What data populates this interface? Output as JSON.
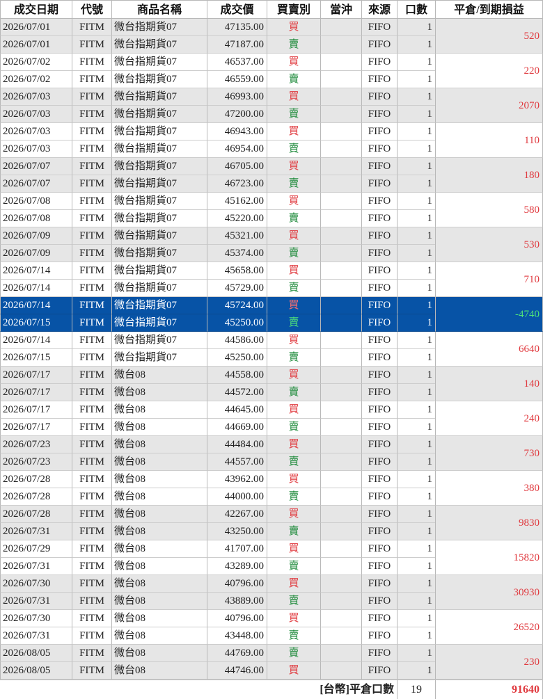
{
  "header": {
    "columns": [
      "成交日期",
      "代號",
      "商品名稱",
      "成交價",
      "買賣別",
      "當沖",
      "來源",
      "口數",
      "平倉/到期損益"
    ]
  },
  "side_labels": {
    "buy": "買",
    "sell": "賣"
  },
  "colors": {
    "buy": "#e0393e",
    "sell": "#1d8a3a",
    "selection": "#0753a6",
    "stripe": "#e6e6e6"
  },
  "pairs": [
    {
      "pnl": "520",
      "selected": false,
      "trades": [
        {
          "date": "2026/07/01",
          "code": "FITM",
          "name": "微台指期貨07",
          "price": "47135.00",
          "side": "buy",
          "daytrade": "",
          "source": "FIFO",
          "qty": "1"
        },
        {
          "date": "2026/07/01",
          "code": "FITM",
          "name": "微台指期貨07",
          "price": "47187.00",
          "side": "sell",
          "daytrade": "",
          "source": "FIFO",
          "qty": "1"
        }
      ]
    },
    {
      "pnl": "220",
      "selected": false,
      "trades": [
        {
          "date": "2026/07/02",
          "code": "FITM",
          "name": "微台指期貨07",
          "price": "46537.00",
          "side": "buy",
          "daytrade": "",
          "source": "FIFO",
          "qty": "1"
        },
        {
          "date": "2026/07/02",
          "code": "FITM",
          "name": "微台指期貨07",
          "price": "46559.00",
          "side": "sell",
          "daytrade": "",
          "source": "FIFO",
          "qty": "1"
        }
      ]
    },
    {
      "pnl": "2070",
      "selected": false,
      "trades": [
        {
          "date": "2026/07/03",
          "code": "FITM",
          "name": "微台指期貨07",
          "price": "46993.00",
          "side": "buy",
          "daytrade": "",
          "source": "FIFO",
          "qty": "1"
        },
        {
          "date": "2026/07/03",
          "code": "FITM",
          "name": "微台指期貨07",
          "price": "47200.00",
          "side": "sell",
          "daytrade": "",
          "source": "FIFO",
          "qty": "1"
        }
      ]
    },
    {
      "pnl": "110",
      "selected": false,
      "trades": [
        {
          "date": "2026/07/03",
          "code": "FITM",
          "name": "微台指期貨07",
          "price": "46943.00",
          "side": "buy",
          "daytrade": "",
          "source": "FIFO",
          "qty": "1"
        },
        {
          "date": "2026/07/03",
          "code": "FITM",
          "name": "微台指期貨07",
          "price": "46954.00",
          "side": "sell",
          "daytrade": "",
          "source": "FIFO",
          "qty": "1"
        }
      ]
    },
    {
      "pnl": "180",
      "selected": false,
      "trades": [
        {
          "date": "2026/07/07",
          "code": "FITM",
          "name": "微台指期貨07",
          "price": "46705.00",
          "side": "buy",
          "daytrade": "",
          "source": "FIFO",
          "qty": "1"
        },
        {
          "date": "2026/07/07",
          "code": "FITM",
          "name": "微台指期貨07",
          "price": "46723.00",
          "side": "sell",
          "daytrade": "",
          "source": "FIFO",
          "qty": "1"
        }
      ]
    },
    {
      "pnl": "580",
      "selected": false,
      "trades": [
        {
          "date": "2026/07/08",
          "code": "FITM",
          "name": "微台指期貨07",
          "price": "45162.00",
          "side": "buy",
          "daytrade": "",
          "source": "FIFO",
          "qty": "1"
        },
        {
          "date": "2026/07/08",
          "code": "FITM",
          "name": "微台指期貨07",
          "price": "45220.00",
          "side": "sell",
          "daytrade": "",
          "source": "FIFO",
          "qty": "1"
        }
      ]
    },
    {
      "pnl": "530",
      "selected": false,
      "trades": [
        {
          "date": "2026/07/09",
          "code": "FITM",
          "name": "微台指期貨07",
          "price": "45321.00",
          "side": "buy",
          "daytrade": "",
          "source": "FIFO",
          "qty": "1"
        },
        {
          "date": "2026/07/09",
          "code": "FITM",
          "name": "微台指期貨07",
          "price": "45374.00",
          "side": "sell",
          "daytrade": "",
          "source": "FIFO",
          "qty": "1"
        }
      ]
    },
    {
      "pnl": "710",
      "selected": false,
      "trades": [
        {
          "date": "2026/07/14",
          "code": "FITM",
          "name": "微台指期貨07",
          "price": "45658.00",
          "side": "buy",
          "daytrade": "",
          "source": "FIFO",
          "qty": "1"
        },
        {
          "date": "2026/07/14",
          "code": "FITM",
          "name": "微台指期貨07",
          "price": "45729.00",
          "side": "sell",
          "daytrade": "",
          "source": "FIFO",
          "qty": "1"
        }
      ]
    },
    {
      "pnl": "-4740",
      "selected": true,
      "trades": [
        {
          "date": "2026/07/14",
          "code": "FITM",
          "name": "微台指期貨07",
          "price": "45724.00",
          "side": "buy",
          "daytrade": "",
          "source": "FIFO",
          "qty": "1"
        },
        {
          "date": "2026/07/15",
          "code": "FITM",
          "name": "微台指期貨07",
          "price": "45250.00",
          "side": "sell",
          "daytrade": "",
          "source": "FIFO",
          "qty": "1"
        }
      ]
    },
    {
      "pnl": "6640",
      "selected": false,
      "trades": [
        {
          "date": "2026/07/14",
          "code": "FITM",
          "name": "微台指期貨07",
          "price": "44586.00",
          "side": "buy",
          "daytrade": "",
          "source": "FIFO",
          "qty": "1"
        },
        {
          "date": "2026/07/15",
          "code": "FITM",
          "name": "微台指期貨07",
          "price": "45250.00",
          "side": "sell",
          "daytrade": "",
          "source": "FIFO",
          "qty": "1"
        }
      ]
    },
    {
      "pnl": "140",
      "selected": false,
      "trades": [
        {
          "date": "2026/07/17",
          "code": "FITM",
          "name": "微台08",
          "price": "44558.00",
          "side": "buy",
          "daytrade": "",
          "source": "FIFO",
          "qty": "1"
        },
        {
          "date": "2026/07/17",
          "code": "FITM",
          "name": "微台08",
          "price": "44572.00",
          "side": "sell",
          "daytrade": "",
          "source": "FIFO",
          "qty": "1"
        }
      ]
    },
    {
      "pnl": "240",
      "selected": false,
      "trades": [
        {
          "date": "2026/07/17",
          "code": "FITM",
          "name": "微台08",
          "price": "44645.00",
          "side": "buy",
          "daytrade": "",
          "source": "FIFO",
          "qty": "1"
        },
        {
          "date": "2026/07/17",
          "code": "FITM",
          "name": "微台08",
          "price": "44669.00",
          "side": "sell",
          "daytrade": "",
          "source": "FIFO",
          "qty": "1"
        }
      ]
    },
    {
      "pnl": "730",
      "selected": false,
      "trades": [
        {
          "date": "2026/07/23",
          "code": "FITM",
          "name": "微台08",
          "price": "44484.00",
          "side": "buy",
          "daytrade": "",
          "source": "FIFO",
          "qty": "1"
        },
        {
          "date": "2026/07/23",
          "code": "FITM",
          "name": "微台08",
          "price": "44557.00",
          "side": "sell",
          "daytrade": "",
          "source": "FIFO",
          "qty": "1"
        }
      ]
    },
    {
      "pnl": "380",
      "selected": false,
      "trades": [
        {
          "date": "2026/07/28",
          "code": "FITM",
          "name": "微台08",
          "price": "43962.00",
          "side": "buy",
          "daytrade": "",
          "source": "FIFO",
          "qty": "1"
        },
        {
          "date": "2026/07/28",
          "code": "FITM",
          "name": "微台08",
          "price": "44000.00",
          "side": "sell",
          "daytrade": "",
          "source": "FIFO",
          "qty": "1"
        }
      ]
    },
    {
      "pnl": "9830",
      "selected": false,
      "trades": [
        {
          "date": "2026/07/28",
          "code": "FITM",
          "name": "微台08",
          "price": "42267.00",
          "side": "buy",
          "daytrade": "",
          "source": "FIFO",
          "qty": "1"
        },
        {
          "date": "2026/07/31",
          "code": "FITM",
          "name": "微台08",
          "price": "43250.00",
          "side": "sell",
          "daytrade": "",
          "source": "FIFO",
          "qty": "1"
        }
      ]
    },
    {
      "pnl": "15820",
      "selected": false,
      "trades": [
        {
          "date": "2026/07/29",
          "code": "FITM",
          "name": "微台08",
          "price": "41707.00",
          "side": "buy",
          "daytrade": "",
          "source": "FIFO",
          "qty": "1"
        },
        {
          "date": "2026/07/31",
          "code": "FITM",
          "name": "微台08",
          "price": "43289.00",
          "side": "sell",
          "daytrade": "",
          "source": "FIFO",
          "qty": "1"
        }
      ]
    },
    {
      "pnl": "30930",
      "selected": false,
      "trades": [
        {
          "date": "2026/07/30",
          "code": "FITM",
          "name": "微台08",
          "price": "40796.00",
          "side": "buy",
          "daytrade": "",
          "source": "FIFO",
          "qty": "1"
        },
        {
          "date": "2026/07/31",
          "code": "FITM",
          "name": "微台08",
          "price": "43889.00",
          "side": "sell",
          "daytrade": "",
          "source": "FIFO",
          "qty": "1"
        }
      ]
    },
    {
      "pnl": "26520",
      "selected": false,
      "trades": [
        {
          "date": "2026/07/30",
          "code": "FITM",
          "name": "微台08",
          "price": "40796.00",
          "side": "buy",
          "daytrade": "",
          "source": "FIFO",
          "qty": "1"
        },
        {
          "date": "2026/07/31",
          "code": "FITM",
          "name": "微台08",
          "price": "43448.00",
          "side": "sell",
          "daytrade": "",
          "source": "FIFO",
          "qty": "1"
        }
      ]
    },
    {
      "pnl": "230",
      "selected": false,
      "trades": [
        {
          "date": "2026/08/05",
          "code": "FITM",
          "name": "微台08",
          "price": "44769.00",
          "side": "sell",
          "daytrade": "",
          "source": "FIFO",
          "qty": "1"
        },
        {
          "date": "2026/08/05",
          "code": "FITM",
          "name": "微台08",
          "price": "44746.00",
          "side": "buy",
          "daytrade": "",
          "source": "FIFO",
          "qty": "1"
        }
      ]
    }
  ],
  "footer": {
    "label": "[台幣]平倉口數",
    "count": "19",
    "total": "91640"
  }
}
